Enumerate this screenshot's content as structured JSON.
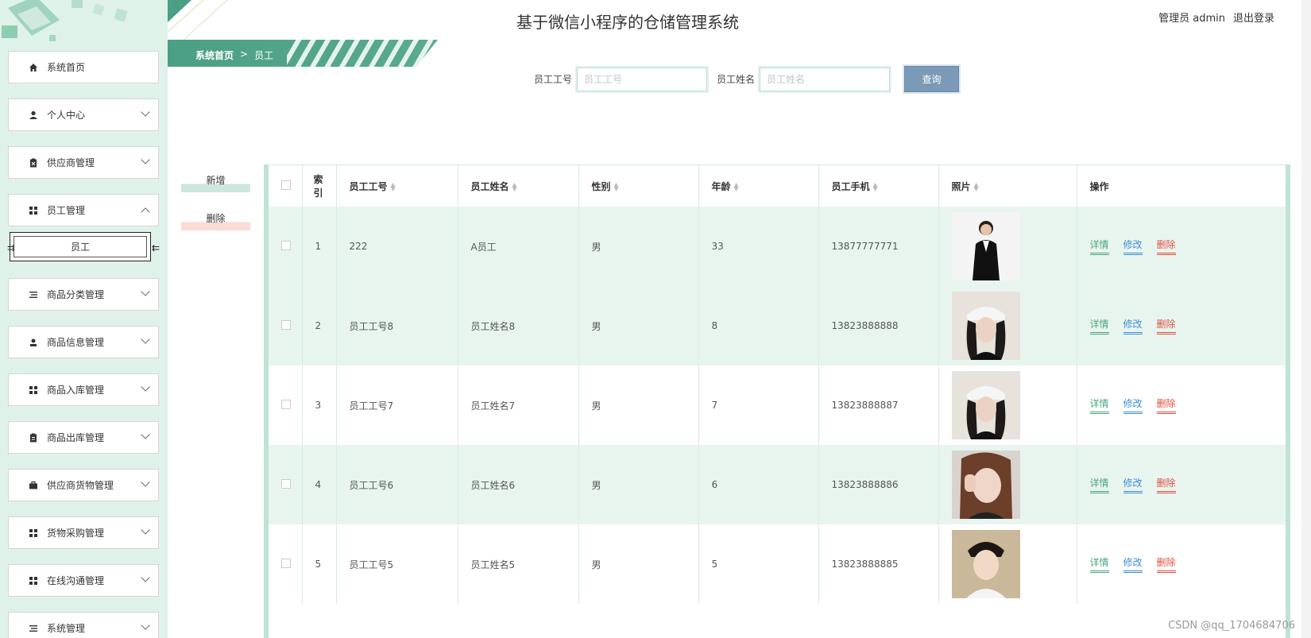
{
  "header": {
    "title": "基于微信小程序的仓储管理系统",
    "user_label": "管理员 admin",
    "logout_label": "退出登录"
  },
  "breadcrumb": {
    "home": "系统首页",
    "separator": ">",
    "current": "员工"
  },
  "sidebar": {
    "items": [
      {
        "label": "系统首页",
        "icon": "home-icon"
      },
      {
        "label": "个人中心",
        "icon": "user-icon"
      },
      {
        "label": "供应商管理",
        "icon": "clipboard-x-icon"
      },
      {
        "label": "员工管理",
        "icon": "grid-icon"
      },
      {
        "label": "员工"
      },
      {
        "label": "商品分类管理",
        "icon": "list-icon"
      },
      {
        "label": "商品信息管理",
        "icon": "person-icon"
      },
      {
        "label": "商品入库管理",
        "icon": "grid-icon"
      },
      {
        "label": "商品出库管理",
        "icon": "clipboard-icon"
      },
      {
        "label": "供应商货物管理",
        "icon": "briefcase-icon"
      },
      {
        "label": "货物采购管理",
        "icon": "grid-icon"
      },
      {
        "label": "在线沟通管理",
        "icon": "grid-icon"
      },
      {
        "label": "系统管理",
        "icon": "list-icon"
      }
    ]
  },
  "search": {
    "id_label": "员工工号",
    "id_placeholder": "员工工号",
    "name_label": "员工姓名",
    "name_placeholder": "员工姓名",
    "query_button": "查询"
  },
  "actions": {
    "add": "新增",
    "delete": "删除"
  },
  "table": {
    "headers": {
      "index": "索引",
      "emp_id": "员工工号",
      "emp_name": "员工姓名",
      "gender": "性别",
      "age": "年龄",
      "phone": "员工手机",
      "photo": "照片",
      "ops": "操作"
    },
    "rows": [
      {
        "index": "1",
        "emp_id": "222",
        "emp_name": "A员工",
        "gender": "男",
        "age": "33",
        "phone": "13877777771"
      },
      {
        "index": "2",
        "emp_id": "员工工号8",
        "emp_name": "员工姓名8",
        "gender": "男",
        "age": "8",
        "phone": "13823888888"
      },
      {
        "index": "3",
        "emp_id": "员工工号7",
        "emp_name": "员工姓名7",
        "gender": "男",
        "age": "7",
        "phone": "13823888887"
      },
      {
        "index": "4",
        "emp_id": "员工工号6",
        "emp_name": "员工姓名6",
        "gender": "男",
        "age": "6",
        "phone": "13823888886"
      },
      {
        "index": "5",
        "emp_id": "员工工号5",
        "emp_name": "员工姓名5",
        "gender": "男",
        "age": "5",
        "phone": "13823888885"
      }
    ],
    "op_labels": {
      "detail": "详情",
      "edit": "修改",
      "remove": "删除"
    }
  },
  "watermark": "CSDN @qq_1704684706",
  "colors": {
    "sidebar_bg": "#dff2ea",
    "accent": "#4b9f84",
    "detail": "#4aa67e",
    "edit": "#3d8fd8",
    "remove": "#e0503f",
    "query_btn": "#7b9ab7"
  }
}
